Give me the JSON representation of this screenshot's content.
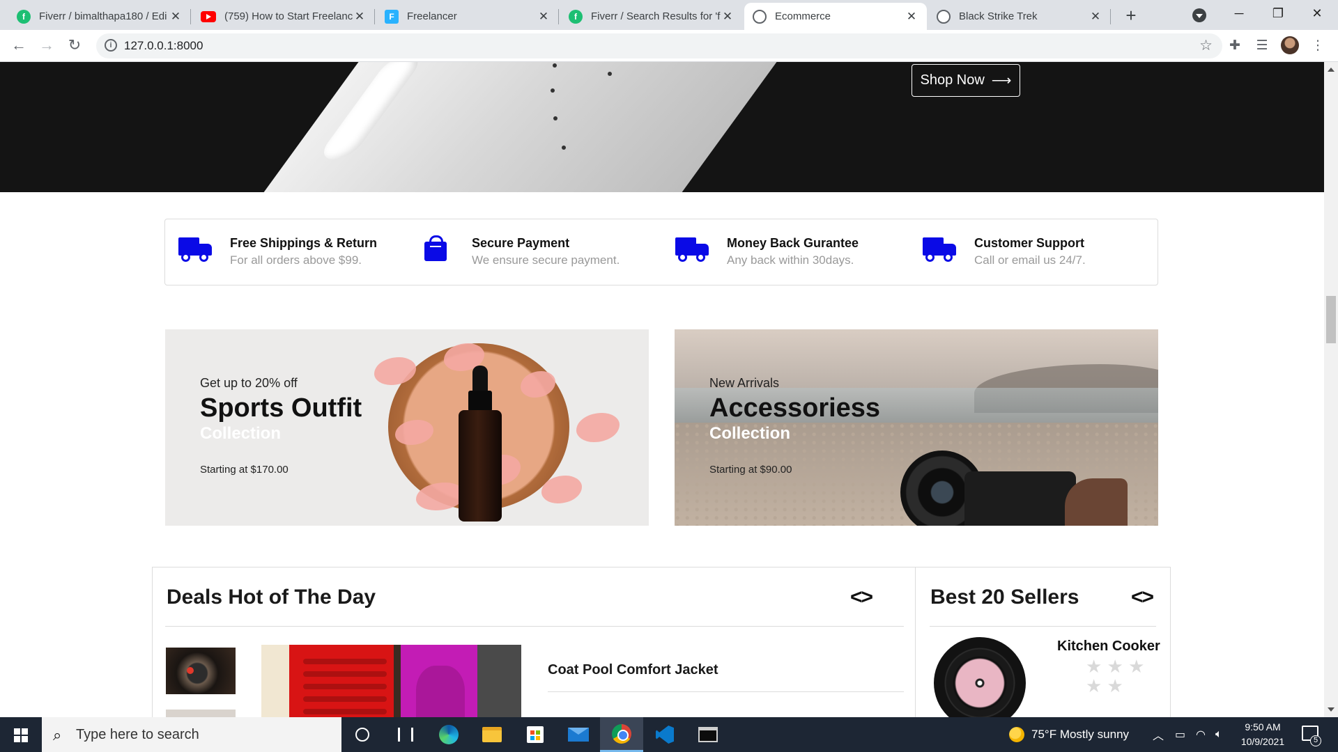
{
  "browser": {
    "tabs": [
      {
        "title": "Fiverr / bimalthapa180 / Edi",
        "favicon": "fiverr-icon",
        "active": false
      },
      {
        "title": "(759) How to Start Freelanci",
        "favicon": "youtube-icon",
        "active": false
      },
      {
        "title": "Freelancer",
        "favicon": "freelancer-icon",
        "active": false
      },
      {
        "title": "Fiverr / Search Results for 'f",
        "favicon": "fiverr-icon",
        "active": false
      },
      {
        "title": "Ecommerce",
        "favicon": "globe-icon",
        "active": true
      },
      {
        "title": "Black Strike Trek",
        "favicon": "globe-icon",
        "active": false
      }
    ],
    "new_tab_symbol": "+",
    "url": "127.0.0.1:8000",
    "window_controls": {
      "minimize": "─",
      "restore": "❐",
      "close": "✕"
    }
  },
  "hero": {
    "shop_now_label": "Shop Now",
    "shop_now_arrow": "⟶"
  },
  "features": [
    {
      "icon": "truck-icon",
      "title": "Free Shippings & Return",
      "desc": "For all orders above $99."
    },
    {
      "icon": "shopping-bag-icon",
      "title": "Secure Payment",
      "desc": "We ensure secure payment."
    },
    {
      "icon": "truck-icon",
      "title": "Money Back Gurantee",
      "desc": "Any back within 30days."
    },
    {
      "icon": "truck-icon",
      "title": "Customer Support",
      "desc": "Call or email us 24/7."
    }
  ],
  "banners": [
    {
      "pre": "Get up to 20% off",
      "heading": "Sports Outfit",
      "sub": "Collection",
      "price": "Starting at $170.00"
    },
    {
      "pre": "New Arrivals",
      "heading": "Accessoriess",
      "sub": "Collection",
      "price": "Starting at $90.00"
    }
  ],
  "deals": {
    "title": "Deals Hot of The Day",
    "nav_symbol": "<>",
    "product_name": "Coat Pool Comfort Jacket"
  },
  "sellers": {
    "title": "Best 20 Sellers",
    "nav_symbol": "<>",
    "item_name": "Kitchen Cooker",
    "rating_stars": "★ ★ ★\n★ ★"
  },
  "taskbar": {
    "search_placeholder": "Type here to search",
    "weather": "75°F  Mostly sunny",
    "time": "9:50 AM",
    "date": "10/9/2021",
    "notification_count": "5"
  },
  "colors": {
    "accent_blue": "#0a0ae6",
    "hero_bg": "#141414",
    "taskbar_bg": "#1d2634"
  }
}
